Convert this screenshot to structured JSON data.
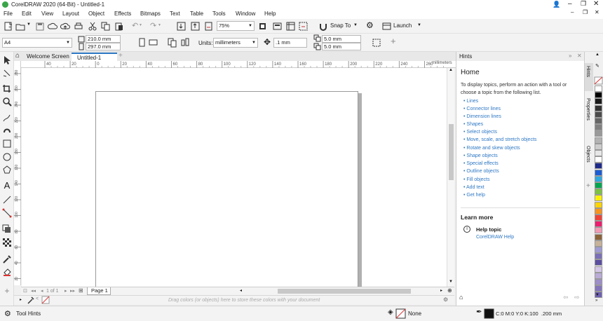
{
  "title": "CorelDRAW 2020 (64-Bit) - Untitled-1",
  "menu": [
    "File",
    "Edit",
    "View",
    "Layout",
    "Object",
    "Effects",
    "Bitmaps",
    "Text",
    "Table",
    "Tools",
    "Window",
    "Help"
  ],
  "stdbar": {
    "zoom": "75%",
    "snap_to": "Snap To",
    "launch": "Launch"
  },
  "propbar": {
    "page_size": "A4",
    "width": "210.0 mm",
    "height": "297.0 mm",
    "units_label": "Units:",
    "units": "millimeters",
    "nudge": ".1 mm",
    "dup_x": "5.0 mm",
    "dup_y": "5.0 mm"
  },
  "tabs": {
    "welcome": "Welcome Screen",
    "doc": "Untitled-1"
  },
  "ruler": {
    "unit": "millimeters",
    "ticks": [
      "40",
      "20",
      "0",
      "20",
      "40",
      "60",
      "80",
      "100",
      "120",
      "140",
      "160",
      "180",
      "200",
      "220",
      "240",
      "260"
    ]
  },
  "ruler_v": [
    "280",
    "260",
    "240",
    "220",
    "200",
    "180",
    "160",
    "140",
    "120",
    "100",
    "80",
    "60",
    "40",
    "20"
  ],
  "nav": {
    "page_info": "1 of 1",
    "page_tab": "Page 1"
  },
  "colortray_text": "Drag colors (or objects) here to store these colors with your document",
  "docker": {
    "header": "Hints",
    "heading": "Home",
    "intro": "To display topics, perform an action with a tool or choose a topic from the following list.",
    "links": [
      "Lines",
      "Connector lines",
      "Dimension lines",
      "Shapes",
      "Select objects",
      "Move, scale, and stretch objects",
      "Rotate and skew objects",
      "Shape objects",
      "Special effects",
      "Outline objects",
      "Fill objects",
      "Add text",
      "Get help"
    ],
    "learn_more": "Learn more",
    "help_topic": "Help topic",
    "help_link": "CorelDRAW Help"
  },
  "dock_tabs": [
    "Hints",
    "Properties",
    "Objects"
  ],
  "status": {
    "tool_hints": "Tool Hints",
    "fill": "None",
    "outline": "C:0 M:0 Y:0 K:100  .200 mm"
  },
  "palette_colors": [
    "#ffffff",
    "#000000",
    "#1a1a1a",
    "#333333",
    "#4d4d4d",
    "#666666",
    "#808080",
    "#999999",
    "#b3b3b3",
    "#cccccc",
    "#e6e6e6",
    "#ffffff",
    "#1f2a8a",
    "#1a5bd6",
    "#2ea8e0",
    "#00a650",
    "#7dc142",
    "#fff200",
    "#ffd400",
    "#f7941d",
    "#ef4136",
    "#ed1c6e",
    "#f39ab5",
    "#8c6239",
    "#c7b299",
    "#a09ad4",
    "#7a6fb8",
    "#5b4ea0",
    "#d4c6e8",
    "#b9aad8",
    "#9d8dc8",
    "#8474bc",
    "#6f5fb0"
  ],
  "accent": "#2f78c4"
}
